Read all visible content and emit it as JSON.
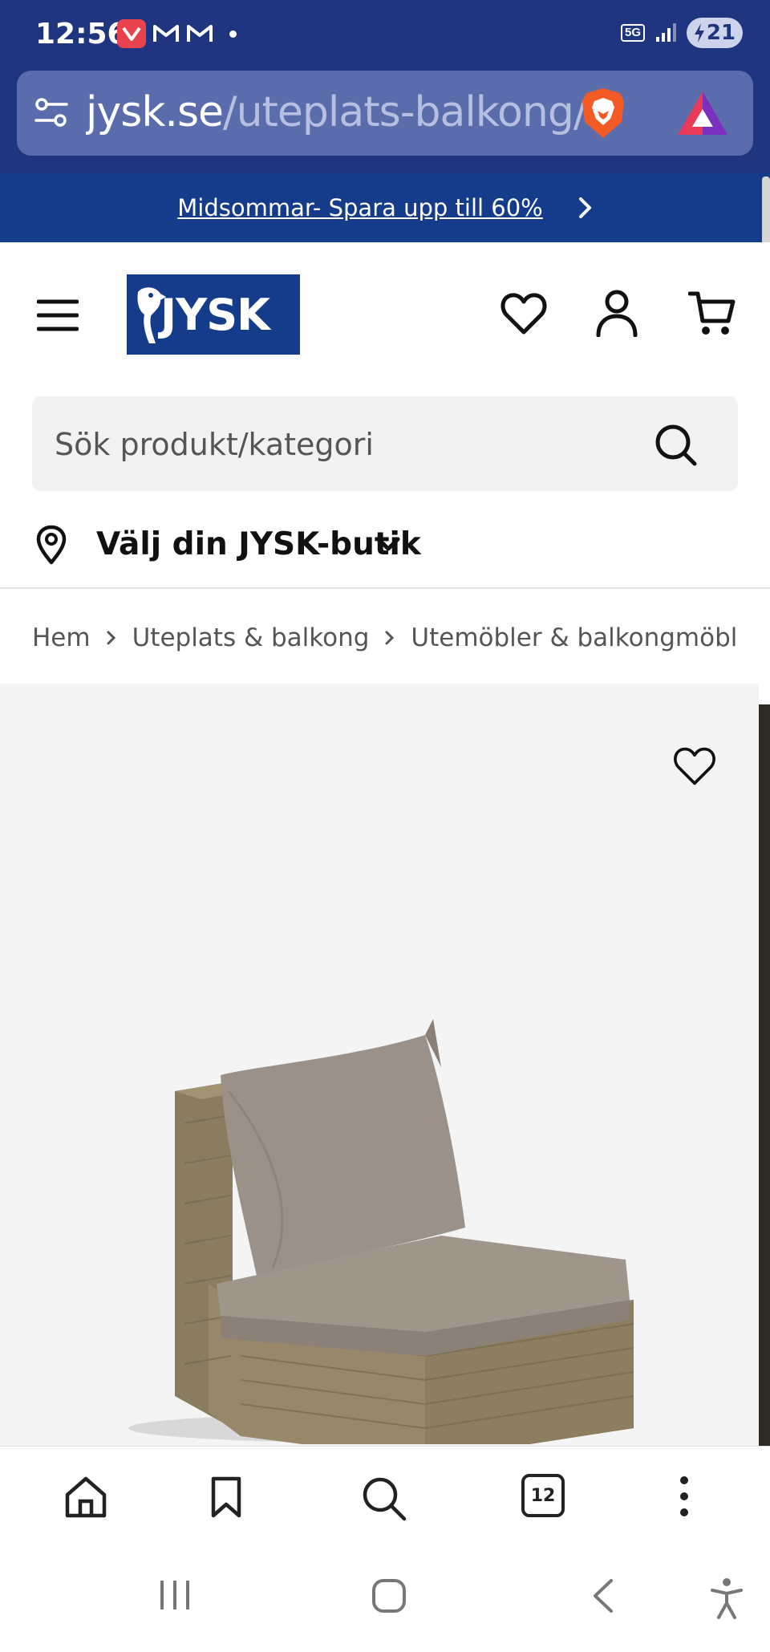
{
  "status_bar": {
    "time": "12:56",
    "network": "5G",
    "battery": "21"
  },
  "browser": {
    "url_domain": "jysk.se",
    "url_path": "/uteplats-balkong/",
    "tab_count": "12"
  },
  "promo": {
    "text": "Midsommar- Spara upp till 60%"
  },
  "header": {
    "logo_text": "JYSK"
  },
  "search": {
    "placeholder": "Sök produkt/kategori"
  },
  "store": {
    "label": "Välj din JYSK-butik"
  },
  "breadcrumb": {
    "items": [
      "Hem",
      "Uteplats & balkong",
      "Utemöbler & balkongmöbler"
    ]
  },
  "colors": {
    "status_bar": "#203580",
    "promo_banner": "#143c8a",
    "logo_bg": "#143c8a",
    "product_bg": "#f4f4f4"
  }
}
